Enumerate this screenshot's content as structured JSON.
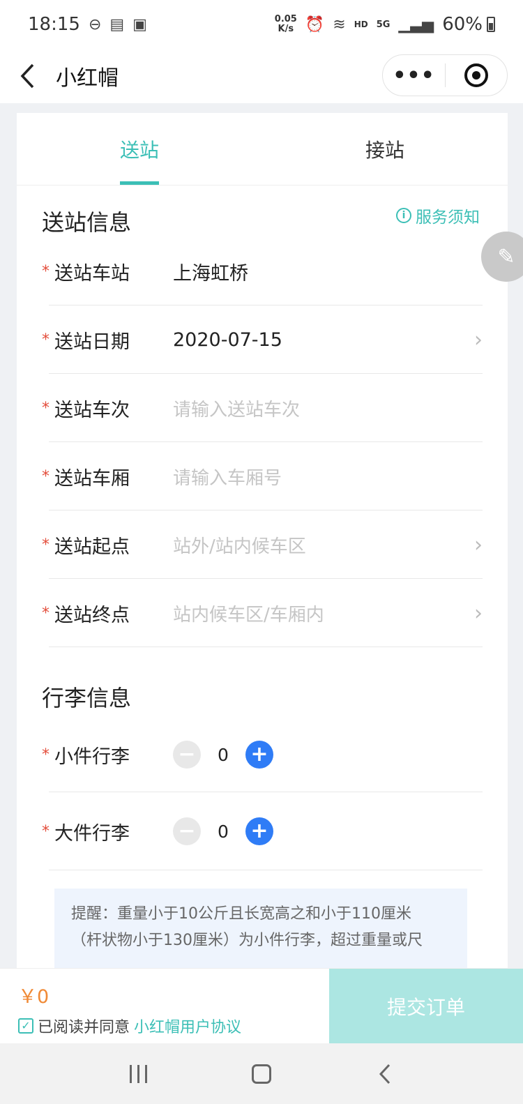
{
  "status_bar": {
    "time": "18:15",
    "speed_value": "0.05",
    "speed_unit": "K/s",
    "network": "HD",
    "signal": "5G",
    "battery": "60%"
  },
  "nav": {
    "title": "小红帽",
    "more_label": "•••"
  },
  "tabs": [
    {
      "label": "送站",
      "active": true
    },
    {
      "label": "接站",
      "active": false
    }
  ],
  "send_section": {
    "title": "送站信息",
    "service_notice": "服务须知",
    "fields": [
      {
        "label": "送站车站",
        "value": "上海虹桥",
        "placeholder": "",
        "has_arrow": false
      },
      {
        "label": "送站日期",
        "value": "2020-07-15",
        "placeholder": "",
        "has_arrow": true
      },
      {
        "label": "送站车次",
        "value": "",
        "placeholder": "请输入送站车次",
        "has_arrow": false
      },
      {
        "label": "送站车厢",
        "value": "",
        "placeholder": "请输入车厢号",
        "has_arrow": false
      },
      {
        "label": "送站起点",
        "value": "",
        "placeholder": "站外/站内候车区",
        "has_arrow": true
      },
      {
        "label": "送站终点",
        "value": "",
        "placeholder": "站内候车区/车厢内",
        "has_arrow": true
      }
    ]
  },
  "luggage_section": {
    "title": "行李信息",
    "items": [
      {
        "label": "小件行李",
        "count": "0"
      },
      {
        "label": "大件行李",
        "count": "0"
      }
    ],
    "notice_line1": "提醒：重量小于10公斤且长宽高之和小于110厘米",
    "notice_line2": "（杆状物小于130厘米）为小件行李，超过重量或尺"
  },
  "footer": {
    "price": "￥0",
    "agree_text": "已阅读并同意",
    "agree_link": "小红帽用户协议",
    "submit_label": "提交订单"
  },
  "colors": {
    "accent": "#3cbfb6",
    "required": "#e34d3b",
    "price": "#f08a36",
    "plus": "#2f7cf6"
  }
}
